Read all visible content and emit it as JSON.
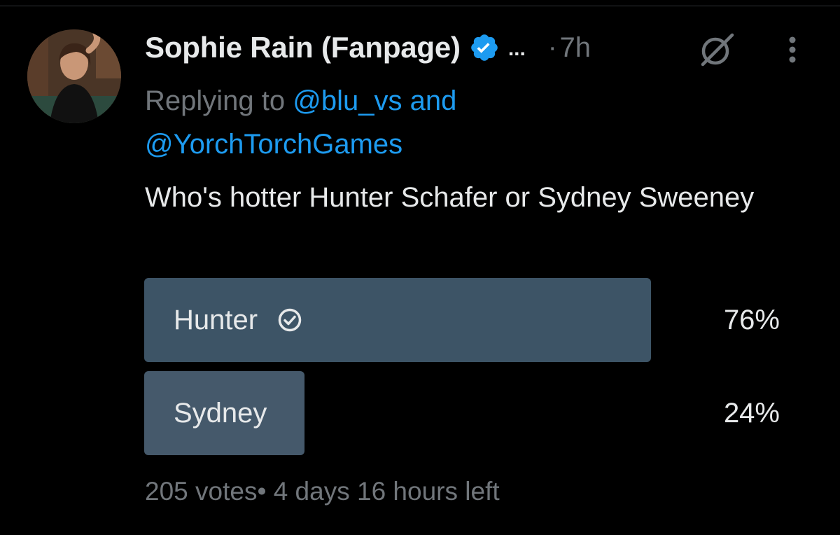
{
  "tweet": {
    "author": {
      "display_name": "Sophie Rain (Fanpage)",
      "verified": true,
      "truncation": "...",
      "avatar_icon": "profile-photo"
    },
    "dot": "·",
    "time": "7h",
    "reply": {
      "prefix": "Replying to",
      "mention_1": "@blu_vs",
      "conjunction": "and",
      "mention_2": "@YorchTorchGames"
    },
    "text": "Who's hotter Hunter Schafer or Sydney Sweeney",
    "icons": {
      "grok": "grok-icon",
      "more": "more-options-icon"
    }
  },
  "poll": {
    "options": [
      {
        "label": "Hunter",
        "percent_text": "76%",
        "percent": 76,
        "winner": true
      },
      {
        "label": "Sydney",
        "percent_text": "24%",
        "percent": 24,
        "winner": false
      }
    ],
    "votes": "205 votes",
    "separator": "•",
    "time_left": "4 days 16 hours left"
  },
  "colors": {
    "background": "#000000",
    "text_primary": "#e7e9ea",
    "text_secondary": "#71767b",
    "accent_blue": "#1d9bf0",
    "poll_winner_bar": "#3d5466",
    "poll_other_bar": "#45596b"
  }
}
